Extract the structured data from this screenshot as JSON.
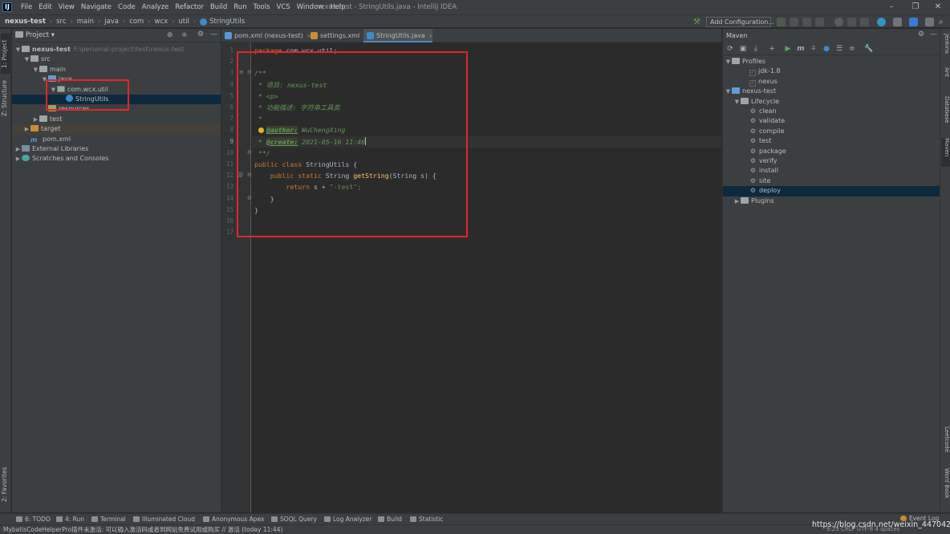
{
  "app": {
    "window_title": "nexus-test - StringUtils.java - IntelliJ IDEA",
    "logo_letter": "IJ",
    "window_controls": [
      "–",
      "❐",
      "✕"
    ]
  },
  "menu": [
    "File",
    "Edit",
    "View",
    "Navigate",
    "Code",
    "Analyze",
    "Refactor",
    "Build",
    "Run",
    "Tools",
    "VCS",
    "Window",
    "Help"
  ],
  "breadcrumb": [
    "nexus-test",
    "src",
    "main",
    "java",
    "com",
    "wcx",
    "util",
    "StringUtils"
  ],
  "toolbar": {
    "run_config": "Add Configuration..."
  },
  "left_stripe": [
    "1: Project",
    "Z: Structure",
    "2: Favorites"
  ],
  "right_stripe": [
    "Jenkins",
    "Ant",
    "Database",
    "Maven",
    "Leetcode",
    "Word Book"
  ],
  "project": {
    "title": "Project",
    "tree": [
      {
        "label": "nexus-test",
        "hint": "F:\\personal-project\\test\\nexus-test",
        "depth": 0,
        "arrow": "▼",
        "icon": "folder",
        "bold": true
      },
      {
        "label": "src",
        "depth": 1,
        "arrow": "▼",
        "icon": "folder"
      },
      {
        "label": "main",
        "depth": 2,
        "arrow": "▼",
        "icon": "folder"
      },
      {
        "label": "java",
        "depth": 3,
        "arrow": "▼",
        "icon": "src"
      },
      {
        "label": "com.wcx.util",
        "depth": 4,
        "arrow": "▼",
        "icon": "pkg"
      },
      {
        "label": "StringUtils",
        "depth": 5,
        "arrow": "",
        "icon": "class",
        "selected": true
      },
      {
        "label": "resources",
        "depth": 3,
        "arrow": "",
        "icon": "res"
      },
      {
        "label": "test",
        "depth": 2,
        "arrow": "▶",
        "icon": "folder"
      },
      {
        "label": "target",
        "depth": 1,
        "arrow": "▶",
        "icon": "target",
        "highlight": true
      },
      {
        "label": "pom.xml",
        "depth": 1,
        "arrow": "",
        "icon": "maven"
      },
      {
        "label": "External Libraries",
        "depth": 0,
        "arrow": "▶",
        "icon": "lib"
      },
      {
        "label": "Scratches and Consoles",
        "depth": 0,
        "arrow": "▶",
        "icon": "scratch"
      }
    ]
  },
  "editor": {
    "tabs": [
      {
        "label": "pom.xml (nexus-test)",
        "icon_color": "#5a97d6"
      },
      {
        "label": "settings.xml",
        "icon_color": "#c78d3a"
      },
      {
        "label": "StringUtils.java",
        "icon_color": "#3d8ac9",
        "active": true
      }
    ],
    "current_line": 9,
    "lines": [
      {
        "n": 1,
        "text": "package com.wcx.util;"
      },
      {
        "n": 2,
        "text": ""
      },
      {
        "n": 3,
        "text": "/**"
      },
      {
        "n": 4,
        "text": " * 项目: nexus-test"
      },
      {
        "n": 5,
        "text": " * <p>"
      },
      {
        "n": 6,
        "text": " * 功能描述: 字符串工具类"
      },
      {
        "n": 7,
        "text": " *"
      },
      {
        "n": 8,
        "text": " * @author: WuChengXing"
      },
      {
        "n": 9,
        "text": " * @create: 2021-05-16 11:46"
      },
      {
        "n": 10,
        "text": " **/"
      },
      {
        "n": 11,
        "text": "public class StringUtils {"
      },
      {
        "n": 12,
        "text": "    public static String getString(String s) {"
      },
      {
        "n": 13,
        "text": "        return s + \"-test\";"
      },
      {
        "n": 14,
        "text": "    }"
      },
      {
        "n": 15,
        "text": "}"
      },
      {
        "n": 16,
        "text": ""
      },
      {
        "n": 17,
        "text": ""
      }
    ],
    "tokens": {
      "kw_package": "package",
      "pkg_name": " com.wcx.util;",
      "doc_open": "/**",
      "doc_project": " * 项目: nexus-test",
      "doc_p": " * <p>",
      "doc_desc": " * 功能描述: 字符串工具类",
      "doc_star": " *",
      "doc_star_prefix": " * ",
      "author_tag": "@author:",
      "author_val": " WuChengXing",
      "create_tag": "@create:",
      "create_val": " 2021-05-16 11:46",
      "doc_close": " **/",
      "kw_public": "public",
      "kw_class": " class",
      "class_name": " StringUtils {",
      "kw_public_static": "    public static",
      "type_string": " String",
      "method_name": " getString",
      "params": "(String s) {",
      "kw_return": "        return",
      "return_expr": " s + ",
      "return_str": "\"-test\"",
      "semicolon": ";",
      "close_method": "    }",
      "close_class": "}"
    }
  },
  "maven": {
    "title": "Maven",
    "tree": [
      {
        "label": "Profiles",
        "depth": 0,
        "arrow": "▼",
        "type": "folder"
      },
      {
        "label": "jdk-1.8",
        "depth": 2,
        "type": "check"
      },
      {
        "label": "nexus",
        "depth": 2,
        "type": "check"
      },
      {
        "label": "nexus-test",
        "depth": 0,
        "arrow": "▼",
        "type": "module"
      },
      {
        "label": "Lifecycle",
        "depth": 1,
        "arrow": "▼",
        "type": "folder"
      },
      {
        "label": "clean",
        "depth": 2,
        "type": "gear"
      },
      {
        "label": "validate",
        "depth": 2,
        "type": "gear"
      },
      {
        "label": "compile",
        "depth": 2,
        "type": "gear"
      },
      {
        "label": "test",
        "depth": 2,
        "type": "gear"
      },
      {
        "label": "package",
        "depth": 2,
        "type": "gear"
      },
      {
        "label": "verify",
        "depth": 2,
        "type": "gear"
      },
      {
        "label": "install",
        "depth": 2,
        "type": "gear"
      },
      {
        "label": "site",
        "depth": 2,
        "type": "gear"
      },
      {
        "label": "deploy",
        "depth": 2,
        "type": "gear",
        "selected": true
      },
      {
        "label": "Plugins",
        "depth": 1,
        "arrow": "▶",
        "type": "folder"
      }
    ]
  },
  "bottom_tabs": [
    "6: TODO",
    "4: Run",
    "Terminal",
    "Illuminated Cloud",
    "Anonymous Apex",
    "SOQL Query",
    "Log Analyzer",
    "Build",
    "Statistic"
  ],
  "event_log": "Event Log",
  "status": {
    "message": "MybatisCodeHelperPro插件未激活: 可以输入激活码或者到网站免费试用或购买 // 激活 (today 11:44)",
    "right": "9:29   CRLF   UTF-8   4 spaces"
  },
  "watermark": "https://blog.csdn.net/weixin_44704261"
}
